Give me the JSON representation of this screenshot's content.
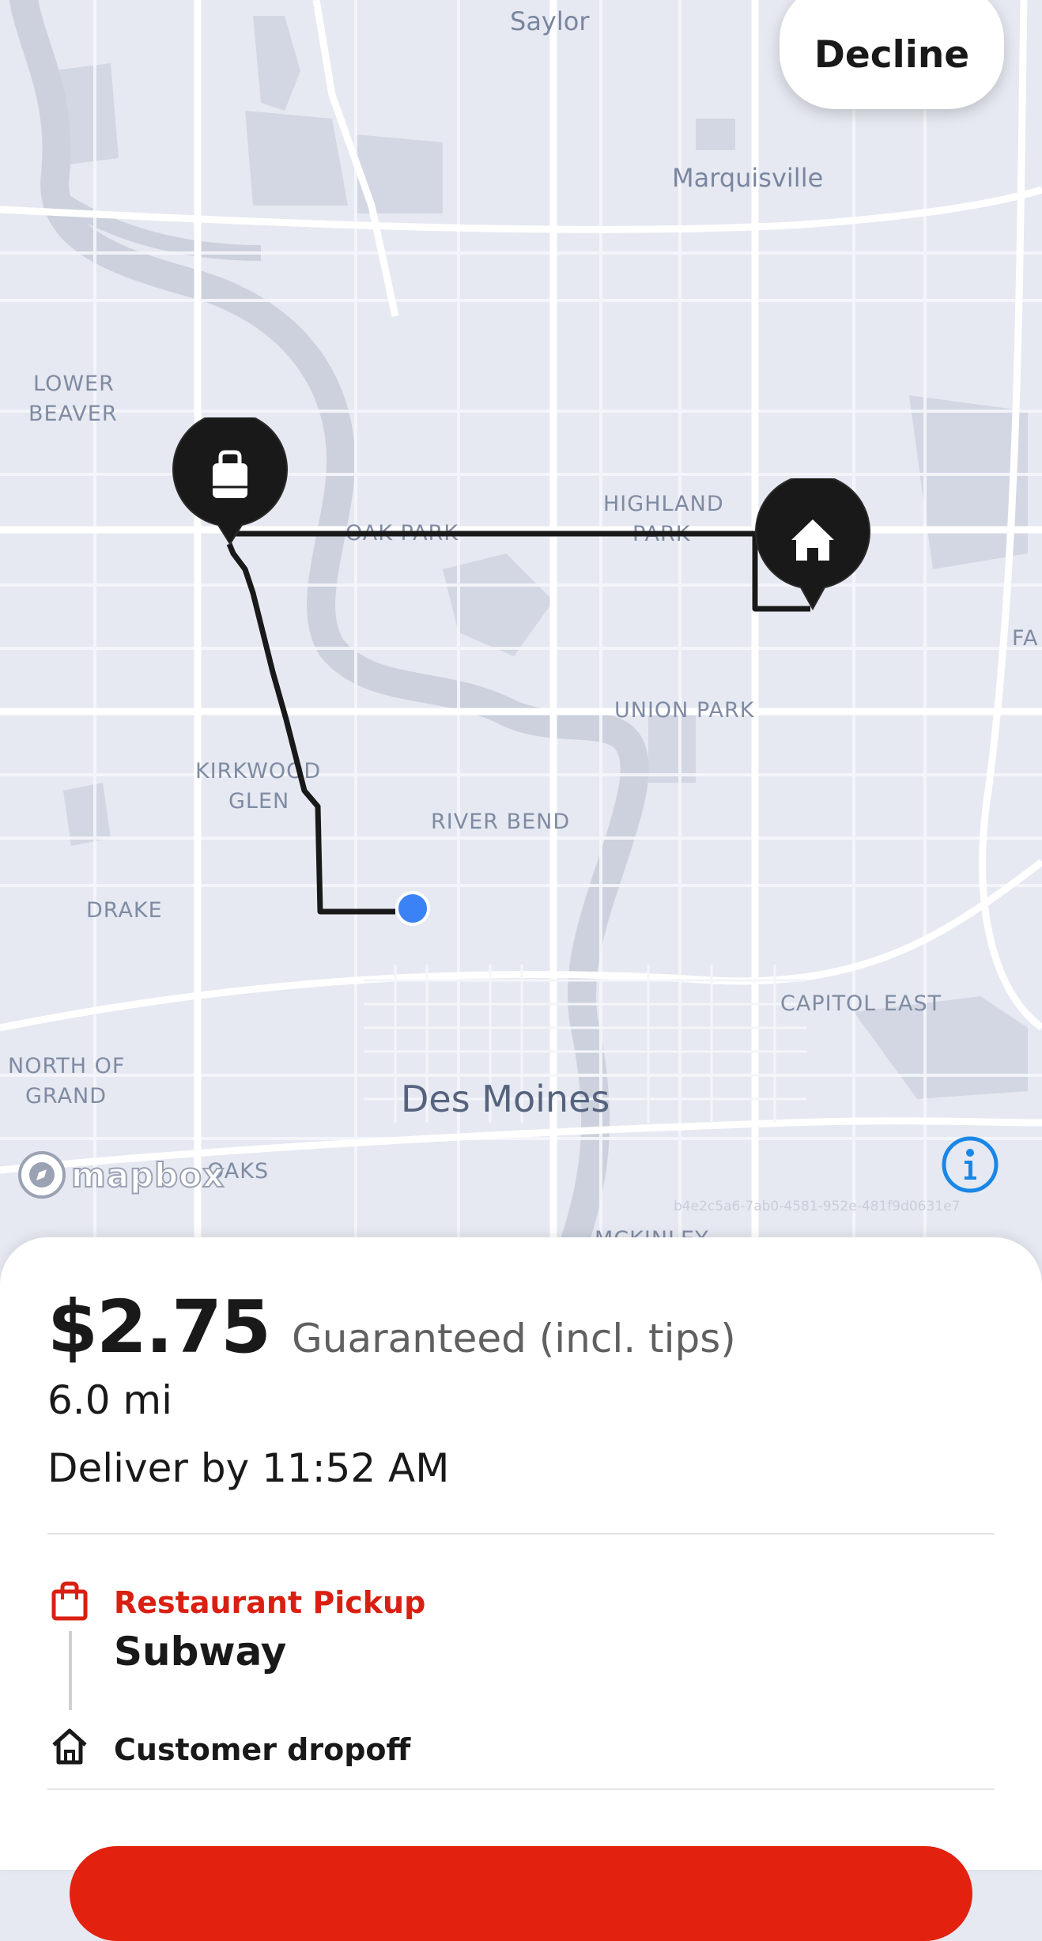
{
  "map": {
    "labels": {
      "saylor": "Saylor",
      "marquisville": "Marquisville",
      "lower_beaver_1": "LOWER",
      "lower_beaver_2": "BEAVER",
      "oak_park": "OAK PARK",
      "highland_park_1": "HIGHLAND",
      "highland_park_2": "PARK",
      "union_park": "UNION PARK",
      "kirkwood_glen_1": "KIRKWOOD",
      "kirkwood_glen_2": "GLEN",
      "river_bend": "RIVER BEND",
      "drake": "DRAKE",
      "capitol_east": "CAPITOL EAST",
      "north_of_grand_1": "NORTH OF",
      "north_of_grand_2": "GRAND",
      "des_moines": "Des Moines",
      "oaks": "OAKS",
      "mckinley": "MCKINLEY",
      "fa": "FA"
    },
    "attribution": "mapbox",
    "map_id": "b4e2c5a6-7ab0-4581-952e-481f9d0631e7",
    "route_color": "#191919",
    "current_location_color": "#3b82f6"
  },
  "header": {
    "decline_label": "Decline"
  },
  "offer": {
    "price": "$2.75",
    "guarantee_text": "Guaranteed (incl. tips)",
    "distance": "6.0 mi",
    "deliver_by": "Deliver by 11:52 AM"
  },
  "stops": {
    "pickup_type": "Restaurant Pickup",
    "pickup_name": "Subway",
    "dropoff_label": "Customer dropoff"
  },
  "colors": {
    "accent_red": "#e3210f",
    "pickup_red": "#d91f11",
    "text_dark": "#191919",
    "text_gray": "#606060",
    "info_blue": "#1a87e6"
  },
  "icons": {
    "pickup_pin": "bag-icon",
    "dropoff_pin": "home-icon",
    "info": "info-icon",
    "mapbox": "mapbox-logo-icon"
  }
}
